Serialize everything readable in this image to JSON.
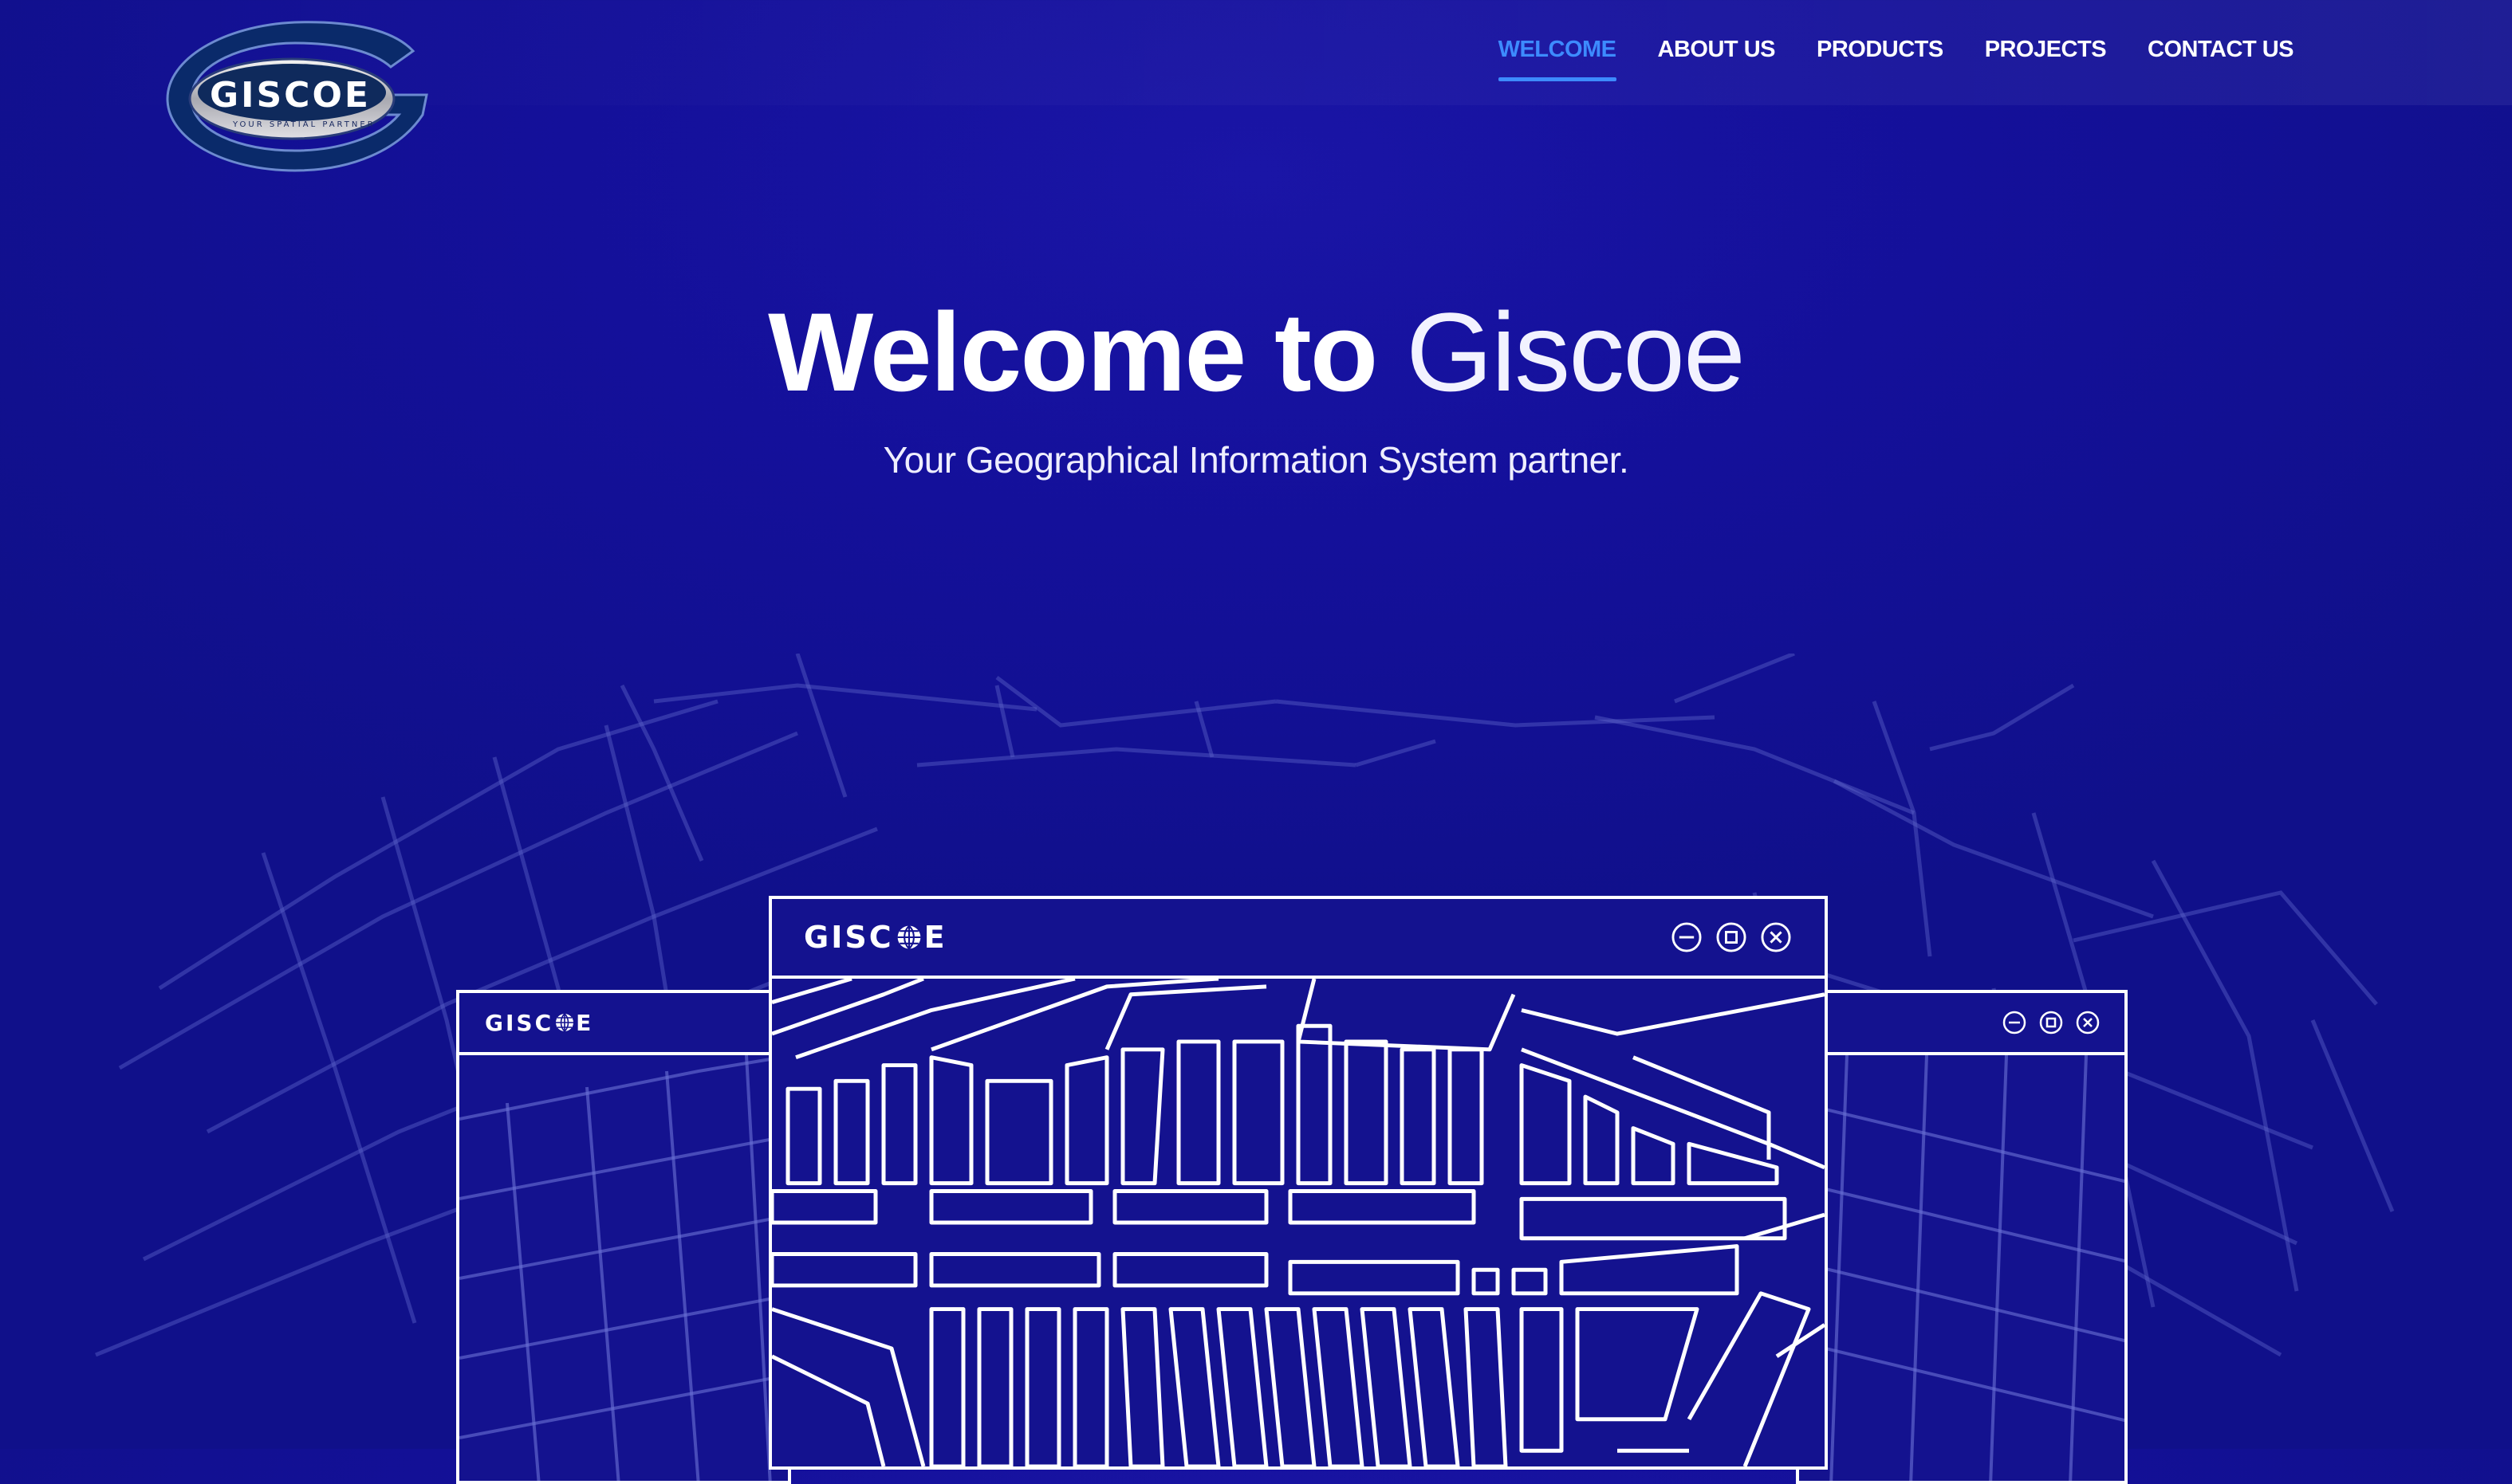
{
  "header": {
    "logo": {
      "text": "GISCOE",
      "tagline": "YOUR SPATIAL PARTNER"
    },
    "nav": [
      {
        "label": "WELCOME",
        "active": true
      },
      {
        "label": "ABOUT US",
        "active": false
      },
      {
        "label": "PRODUCTS",
        "active": false
      },
      {
        "label": "PROJECTS",
        "active": false
      },
      {
        "label": "CONTACT US",
        "active": false
      }
    ]
  },
  "hero": {
    "title_strong": "Welcome to",
    "title_light": "Giscoe",
    "subtitle": "Your Geographical Information System partner."
  },
  "windows": {
    "left_brand": "GISC",
    "left_brand_end": "E",
    "main_brand": "GISC",
    "main_brand_end": "E"
  },
  "colors": {
    "background": "#14109a",
    "nav_active": "#3d8bff",
    "text": "#ffffff"
  },
  "icons": [
    "globe-icon",
    "minimize-icon",
    "maximize-icon",
    "close-icon"
  ]
}
